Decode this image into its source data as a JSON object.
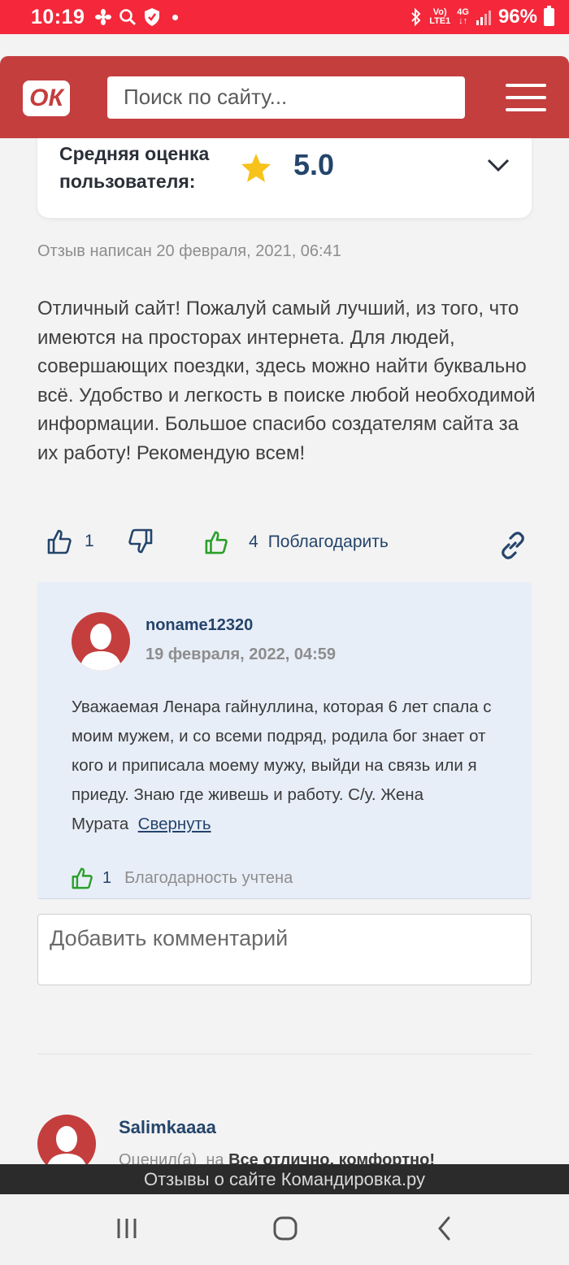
{
  "status_bar": {
    "time": "10:19",
    "network_top": "Vo)",
    "network_bottom": "LTE1",
    "net_type": "4G",
    "battery": "96%"
  },
  "header": {
    "logo_text": "ОК",
    "search_placeholder": "Поиск по сайту..."
  },
  "rating": {
    "label": "Средняя оценка пользователя:",
    "value": "5.0",
    "star_color": "#f7c21a"
  },
  "review": {
    "date": "Отзыв написан 20 февраля, 2021, 06:41",
    "text": "Отличный сайт! Пожалуй самый лучший, из того, что имеются на просторах интернета. Для людей, совершающих поездки, здесь можно найти буквально всё. Удобство и легкость в поиске любой необходимой информации. Большое спасибо создателям сайта за их работу! Рекомендую всем!",
    "likes": "1",
    "thanks_count": "4",
    "thanks_label": "Поблагодарить"
  },
  "reply": {
    "username": "noname12320",
    "date": "19 февраля, 2022, 04:59",
    "text": "Уважаемая Ленара гайнуллина, которая 6 лет спала с моим мужем, и со всеми подряд, родила бог знает от кого и приписала моему мужу, выйди на связь или я приеду. Знаю где живешь и работу. С/у. Жена Мурата",
    "collapse_label": "Свернуть",
    "thanks_count": "1",
    "thanks_status": "Благодарность учтена"
  },
  "comment": {
    "placeholder": "Добавить комментарий"
  },
  "next_review": {
    "username": "Salimkaaaa",
    "sub_prefix": "Оценил(а)",
    "sub_on": "на",
    "sub_bold": "Все отлично, комфортно!"
  },
  "footer": {
    "title": "Отзывы о сайте Командировка.ру"
  },
  "colors": {
    "status_bar": "#f4283a",
    "header": "#c43e3e",
    "link": "#24446b",
    "thumb_green": "#2aa02a",
    "reply_bg": "#e8eef8"
  }
}
